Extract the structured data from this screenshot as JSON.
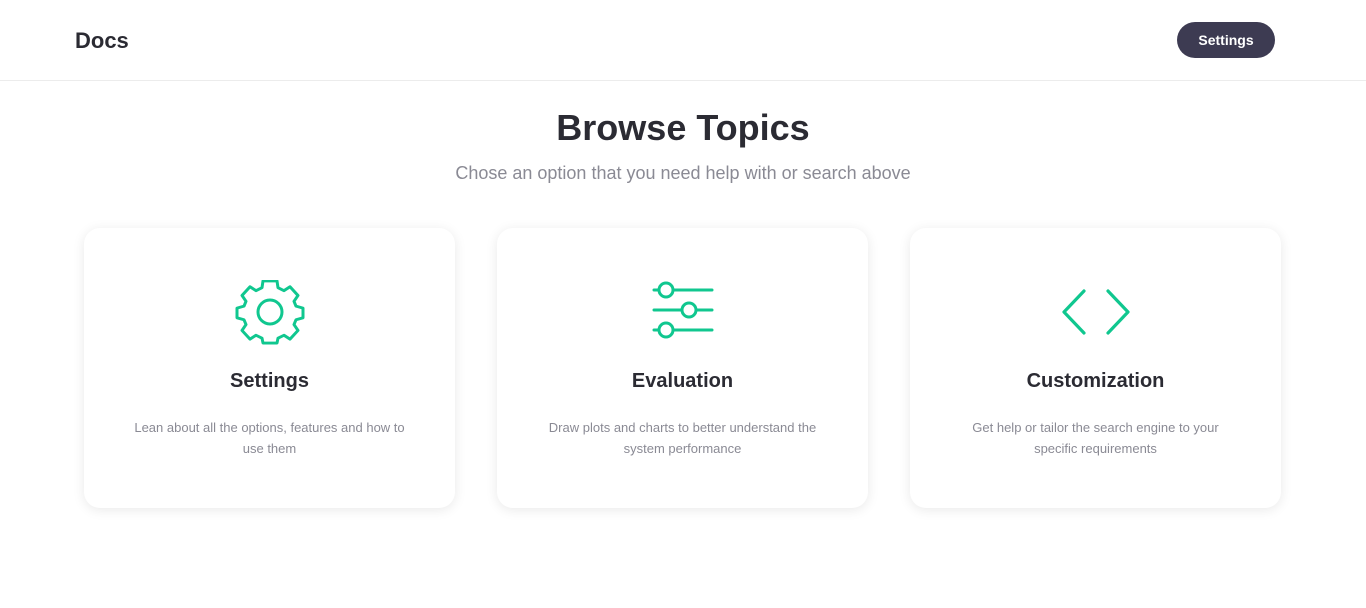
{
  "header": {
    "brand": "Docs",
    "settings_label": "Settings"
  },
  "main": {
    "title": "Browse Topics",
    "subtitle": "Chose an option that you need help with or search above"
  },
  "accent_color": "#10c78f",
  "cards": [
    {
      "icon": "gear-icon",
      "title": "Settings",
      "description": "Lean about all the options, features and how to use them"
    },
    {
      "icon": "sliders-icon",
      "title": "Evaluation",
      "description": "Draw plots and charts to better understand the system performance"
    },
    {
      "icon": "code-brackets-icon",
      "title": "Customization",
      "description": "Get help or tailor the search engine to your specific requirements"
    }
  ]
}
